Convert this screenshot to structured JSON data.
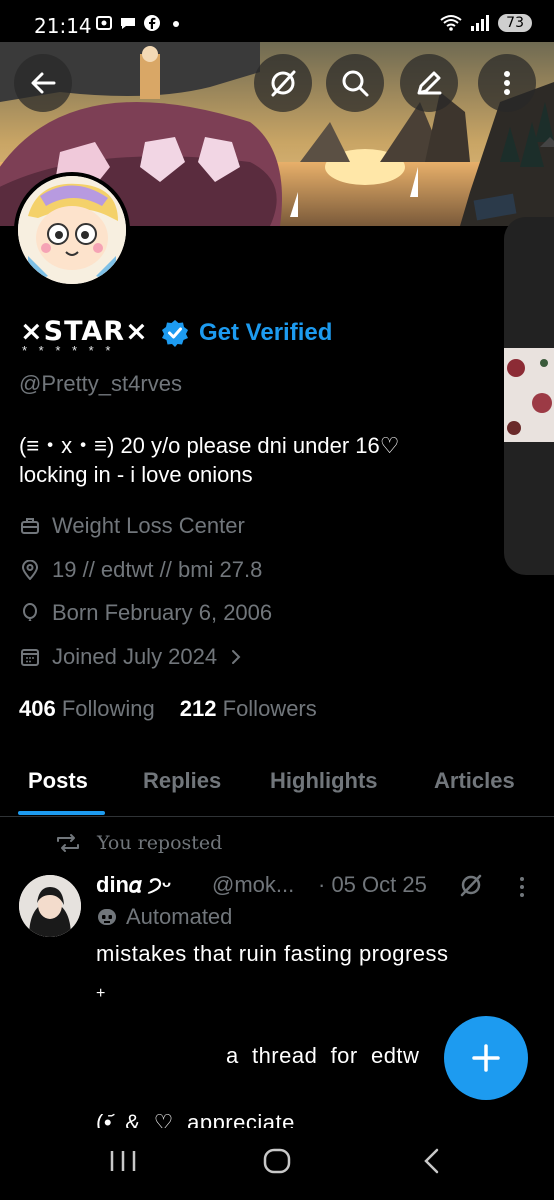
{
  "status": {
    "time": "21:14",
    "battery": "73"
  },
  "profile": {
    "name": "×STAR×",
    "name_stars": "* * * * * *",
    "get_verified": "Get Verified",
    "handle": "@Pretty_st4rves",
    "bio_line1": "(≡・x・≡) 20 y/o please dni under 16♡",
    "bio_line2": "locking in - i love onions",
    "category": "Weight Loss Center",
    "location": "19 // edtwt // bmi 27.8",
    "born": "Born February 6, 2006",
    "joined": "Joined July 2024",
    "following_count": "406",
    "following_label": "Following",
    "followers_count": "212",
    "followers_label": "Followers"
  },
  "tabs": [
    "Posts",
    "Replies",
    "Highlights",
    "Articles"
  ],
  "post": {
    "repost_label": "You reposted",
    "author_name": "din𝛼 ੭ᵕ",
    "author_handle": "@mok...",
    "date": "· 05 Oct 25",
    "automated_label": "Automated",
    "line1": "mistakes that ruin fasting progress",
    "line2": "+",
    "line3": "a  thread  for  edtw",
    "line4": "(•᷄  &  ♡  appreciate"
  },
  "colors": {
    "accent": "#1d9bf0",
    "muted": "#71767b",
    "background": "#000000"
  }
}
